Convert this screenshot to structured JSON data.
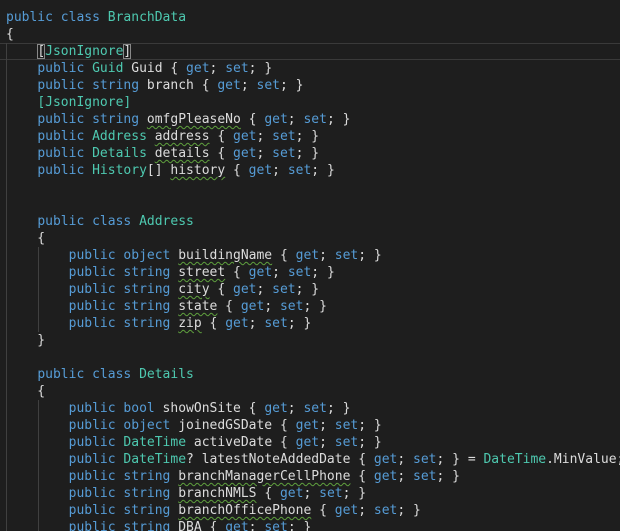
{
  "editor": {
    "lines": [
      [
        {
          "t": "public",
          "c": "kw"
        },
        {
          "t": " "
        },
        {
          "t": "class",
          "c": "kw"
        },
        {
          "t": " "
        },
        {
          "t": "BranchData",
          "c": "type"
        }
      ],
      [
        {
          "t": "{"
        }
      ],
      [
        {
          "t": "    "
        },
        {
          "t": "[",
          "c": "bracket-hl"
        },
        {
          "t": "JsonIgnore",
          "c": "attr"
        },
        {
          "t": "]",
          "c": "bracket-hl"
        }
      ],
      [
        {
          "t": "    "
        },
        {
          "t": "public",
          "c": "kw"
        },
        {
          "t": " "
        },
        {
          "t": "Guid",
          "c": "type"
        },
        {
          "t": " Guid { "
        },
        {
          "t": "get",
          "c": "kw"
        },
        {
          "t": "; "
        },
        {
          "t": "set",
          "c": "kw"
        },
        {
          "t": "; }"
        }
      ],
      [
        {
          "t": "    "
        },
        {
          "t": "public",
          "c": "kw"
        },
        {
          "t": " "
        },
        {
          "t": "string",
          "c": "kw"
        },
        {
          "t": " branch { "
        },
        {
          "t": "get",
          "c": "kw"
        },
        {
          "t": "; "
        },
        {
          "t": "set",
          "c": "kw"
        },
        {
          "t": "; }"
        }
      ],
      [
        {
          "t": "    "
        },
        {
          "t": "[JsonIgnore]",
          "c": "attr"
        }
      ],
      [
        {
          "t": "    "
        },
        {
          "t": "public",
          "c": "kw"
        },
        {
          "t": " "
        },
        {
          "t": "string",
          "c": "kw"
        },
        {
          "t": " "
        },
        {
          "t": "omfgPleaseNo",
          "s": true
        },
        {
          "t": " { "
        },
        {
          "t": "get",
          "c": "kw"
        },
        {
          "t": "; "
        },
        {
          "t": "set",
          "c": "kw"
        },
        {
          "t": "; }"
        }
      ],
      [
        {
          "t": "    "
        },
        {
          "t": "public",
          "c": "kw"
        },
        {
          "t": " "
        },
        {
          "t": "Address",
          "c": "type"
        },
        {
          "t": " "
        },
        {
          "t": "address",
          "s": true
        },
        {
          "t": " { "
        },
        {
          "t": "get",
          "c": "kw"
        },
        {
          "t": "; "
        },
        {
          "t": "set",
          "c": "kw"
        },
        {
          "t": "; }"
        }
      ],
      [
        {
          "t": "    "
        },
        {
          "t": "public",
          "c": "kw"
        },
        {
          "t": " "
        },
        {
          "t": "Details",
          "c": "type"
        },
        {
          "t": " "
        },
        {
          "t": "details",
          "s": true
        },
        {
          "t": " { "
        },
        {
          "t": "get",
          "c": "kw"
        },
        {
          "t": "; "
        },
        {
          "t": "set",
          "c": "kw"
        },
        {
          "t": "; }"
        }
      ],
      [
        {
          "t": "    "
        },
        {
          "t": "public",
          "c": "kw"
        },
        {
          "t": " "
        },
        {
          "t": "History",
          "c": "type"
        },
        {
          "t": "[] "
        },
        {
          "t": "history",
          "s": true
        },
        {
          "t": " { "
        },
        {
          "t": "get",
          "c": "kw"
        },
        {
          "t": "; "
        },
        {
          "t": "set",
          "c": "kw"
        },
        {
          "t": "; }"
        }
      ],
      [],
      [],
      [
        {
          "t": "    "
        },
        {
          "t": "public",
          "c": "kw"
        },
        {
          "t": " "
        },
        {
          "t": "class",
          "c": "kw"
        },
        {
          "t": " "
        },
        {
          "t": "Address",
          "c": "type"
        }
      ],
      [
        {
          "t": "    {"
        }
      ],
      [
        {
          "t": "        "
        },
        {
          "t": "public",
          "c": "kw"
        },
        {
          "t": " "
        },
        {
          "t": "object",
          "c": "kw"
        },
        {
          "t": " "
        },
        {
          "t": "buildingName",
          "s": true
        },
        {
          "t": " { "
        },
        {
          "t": "get",
          "c": "kw"
        },
        {
          "t": "; "
        },
        {
          "t": "set",
          "c": "kw"
        },
        {
          "t": "; }"
        }
      ],
      [
        {
          "t": "        "
        },
        {
          "t": "public",
          "c": "kw"
        },
        {
          "t": " "
        },
        {
          "t": "string",
          "c": "kw"
        },
        {
          "t": " "
        },
        {
          "t": "street",
          "s": true
        },
        {
          "t": " { "
        },
        {
          "t": "get",
          "c": "kw"
        },
        {
          "t": "; "
        },
        {
          "t": "set",
          "c": "kw"
        },
        {
          "t": "; }"
        }
      ],
      [
        {
          "t": "        "
        },
        {
          "t": "public",
          "c": "kw"
        },
        {
          "t": " "
        },
        {
          "t": "string",
          "c": "kw"
        },
        {
          "t": " "
        },
        {
          "t": "city",
          "s": true
        },
        {
          "t": " { "
        },
        {
          "t": "get",
          "c": "kw"
        },
        {
          "t": "; "
        },
        {
          "t": "set",
          "c": "kw"
        },
        {
          "t": "; }"
        }
      ],
      [
        {
          "t": "        "
        },
        {
          "t": "public",
          "c": "kw"
        },
        {
          "t": " "
        },
        {
          "t": "string",
          "c": "kw"
        },
        {
          "t": " "
        },
        {
          "t": "state",
          "s": true
        },
        {
          "t": " { "
        },
        {
          "t": "get",
          "c": "kw"
        },
        {
          "t": "; "
        },
        {
          "t": "set",
          "c": "kw"
        },
        {
          "t": "; }"
        }
      ],
      [
        {
          "t": "        "
        },
        {
          "t": "public",
          "c": "kw"
        },
        {
          "t": " "
        },
        {
          "t": "string",
          "c": "kw"
        },
        {
          "t": " "
        },
        {
          "t": "zip",
          "s": true
        },
        {
          "t": " { "
        },
        {
          "t": "get",
          "c": "kw"
        },
        {
          "t": "; "
        },
        {
          "t": "set",
          "c": "kw"
        },
        {
          "t": "; }"
        }
      ],
      [
        {
          "t": "    }"
        }
      ],
      [],
      [
        {
          "t": "    "
        },
        {
          "t": "public",
          "c": "kw"
        },
        {
          "t": " "
        },
        {
          "t": "class",
          "c": "kw"
        },
        {
          "t": " "
        },
        {
          "t": "Details",
          "c": "type"
        }
      ],
      [
        {
          "t": "    {"
        }
      ],
      [
        {
          "t": "        "
        },
        {
          "t": "public",
          "c": "kw"
        },
        {
          "t": " "
        },
        {
          "t": "bool",
          "c": "kw"
        },
        {
          "t": " showOnSite { "
        },
        {
          "t": "get",
          "c": "kw"
        },
        {
          "t": "; "
        },
        {
          "t": "set",
          "c": "kw"
        },
        {
          "t": "; }"
        }
      ],
      [
        {
          "t": "        "
        },
        {
          "t": "public",
          "c": "kw"
        },
        {
          "t": " "
        },
        {
          "t": "object",
          "c": "kw"
        },
        {
          "t": " joinedGSDate { "
        },
        {
          "t": "get",
          "c": "kw"
        },
        {
          "t": "; "
        },
        {
          "t": "set",
          "c": "kw"
        },
        {
          "t": "; }"
        }
      ],
      [
        {
          "t": "        "
        },
        {
          "t": "public",
          "c": "kw"
        },
        {
          "t": " "
        },
        {
          "t": "DateTime",
          "c": "type"
        },
        {
          "t": " activeDate { "
        },
        {
          "t": "get",
          "c": "kw"
        },
        {
          "t": "; "
        },
        {
          "t": "set",
          "c": "kw"
        },
        {
          "t": "; }"
        }
      ],
      [
        {
          "t": "        "
        },
        {
          "t": "public",
          "c": "kw"
        },
        {
          "t": " "
        },
        {
          "t": "DateTime",
          "c": "type"
        },
        {
          "t": "? latestNoteAddedDate { "
        },
        {
          "t": "get",
          "c": "kw"
        },
        {
          "t": "; "
        },
        {
          "t": "set",
          "c": "kw"
        },
        {
          "t": "; } = "
        },
        {
          "t": "DateTime",
          "c": "type"
        },
        {
          "t": ".MinValue;"
        }
      ],
      [
        {
          "t": "        "
        },
        {
          "t": "public",
          "c": "kw"
        },
        {
          "t": " "
        },
        {
          "t": "string",
          "c": "kw"
        },
        {
          "t": " "
        },
        {
          "t": "branchManagerCellPhone",
          "s": true
        },
        {
          "t": " { "
        },
        {
          "t": "get",
          "c": "kw"
        },
        {
          "t": "; "
        },
        {
          "t": "set",
          "c": "kw"
        },
        {
          "t": "; }"
        }
      ],
      [
        {
          "t": "        "
        },
        {
          "t": "public",
          "c": "kw"
        },
        {
          "t": " "
        },
        {
          "t": "string",
          "c": "kw"
        },
        {
          "t": " "
        },
        {
          "t": "branchNMLS",
          "s": true
        },
        {
          "t": " { "
        },
        {
          "t": "get",
          "c": "kw"
        },
        {
          "t": "; "
        },
        {
          "t": "set",
          "c": "kw"
        },
        {
          "t": "; }"
        }
      ],
      [
        {
          "t": "        "
        },
        {
          "t": "public",
          "c": "kw"
        },
        {
          "t": " "
        },
        {
          "t": "string",
          "c": "kw"
        },
        {
          "t": " "
        },
        {
          "t": "branchOfficePhone",
          "s": true
        },
        {
          "t": " { "
        },
        {
          "t": "get",
          "c": "kw"
        },
        {
          "t": "; "
        },
        {
          "t": "set",
          "c": "kw"
        },
        {
          "t": "; }"
        }
      ],
      [
        {
          "t": "        "
        },
        {
          "t": "public",
          "c": "kw"
        },
        {
          "t": " "
        },
        {
          "t": "string",
          "c": "kw"
        },
        {
          "t": " "
        },
        {
          "t": "DBA",
          "s": true
        },
        {
          "t": " { "
        },
        {
          "t": "get",
          "c": "kw"
        },
        {
          "t": "; "
        },
        {
          "t": "set",
          "c": "kw"
        },
        {
          "t": "; }"
        }
      ]
    ]
  }
}
